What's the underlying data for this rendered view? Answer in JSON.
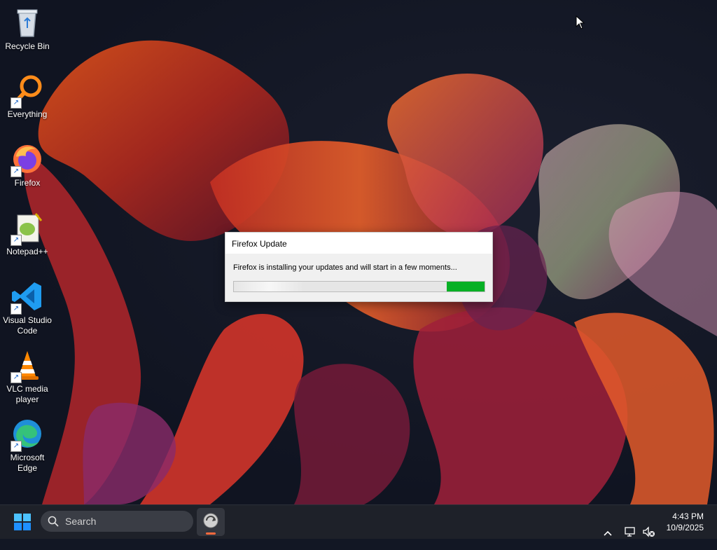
{
  "desktop": {
    "icons": [
      {
        "label": "Recycle Bin",
        "icon": "recycle-bin-icon"
      },
      {
        "label": "Everything",
        "icon": "everything-search-icon"
      },
      {
        "label": "Firefox",
        "icon": "firefox-icon"
      },
      {
        "label": "Notepad++",
        "icon": "notepad-plus-plus-icon"
      },
      {
        "label_line1": "Visual Studio",
        "label_line2": "Code",
        "icon": "vscode-icon"
      },
      {
        "label_line1": "VLC media",
        "label_line2": "player",
        "icon": "vlc-icon"
      },
      {
        "label_line1": "Microsoft",
        "label_line2": "Edge",
        "icon": "edge-icon"
      }
    ]
  },
  "dialog": {
    "title": "Firefox Update",
    "message": "Firefox is installing your updates and will start in a few moments...",
    "progress_fill_fraction": 0.15,
    "progress_color": "#06b025"
  },
  "taskbar": {
    "search_placeholder": "Search",
    "running_app_icon": "firefox-updater-icon",
    "accent_indicator_color": "#ff6a3d",
    "clock_time": "4:43 PM",
    "clock_date": "10/9/2025"
  },
  "colors": {
    "taskbar_bg": "#1e2129",
    "windows_blue": "#1e90ff"
  }
}
